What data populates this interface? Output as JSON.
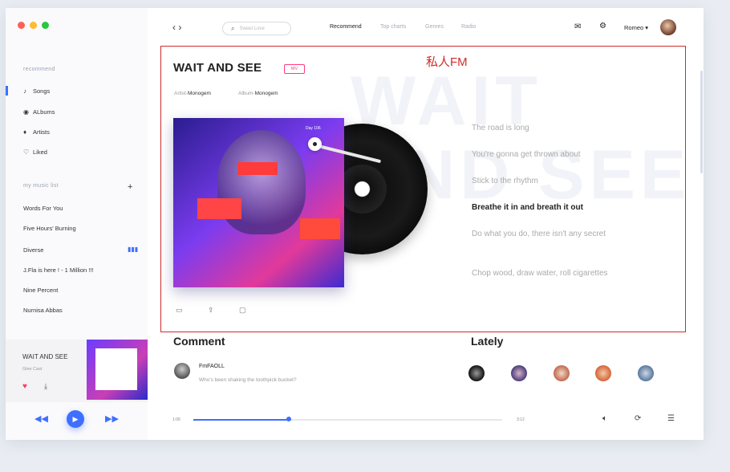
{
  "colors": {
    "accent": "#3f6fff",
    "annotation": "#d12b2b",
    "mv": "#ff3b7c",
    "heart": "#ff3b5c",
    "dot_red": "#ff5f57",
    "dot_yellow": "#febc2e",
    "dot_green": "#28c840"
  },
  "sidebar": {
    "recommend_title": "recommend",
    "nav": [
      {
        "label": "Songs",
        "icon": "note-icon",
        "glyph": "♪"
      },
      {
        "label": "ALbums",
        "icon": "disc-icon",
        "glyph": "◉"
      },
      {
        "label": "Artists",
        "icon": "mic-icon",
        "glyph": "♦"
      },
      {
        "label": "Liked",
        "icon": "heart-outline-icon",
        "glyph": "♡"
      }
    ],
    "music_list_title": "my music list",
    "add_glyph": "+",
    "playlists": [
      "Words For You",
      "Five Hours' Burning",
      "Diverse",
      "J.Fla is here !  - 1 Million !!!",
      "Nine Percent",
      "Nurnisa Abbas"
    ],
    "now_playing": {
      "title": "WAIT AND SEE",
      "artist": "Glee Cast"
    }
  },
  "top": {
    "search_placeholder": "Sweet Love",
    "tabs": [
      "Recommend",
      "Top charts",
      "Genres",
      "Radio"
    ],
    "user": "Romeo ▾"
  },
  "fm": {
    "annotation": "私人FM",
    "title": "WAIT AND SEE",
    "mv": "MV",
    "artist_label": "Artist-",
    "artist": "Monogem",
    "album_label": "Album-",
    "album": "Monogem",
    "cover_day": "Day 106",
    "bg_text": "WAIT AND SEE",
    "lyrics": [
      "The road is long",
      "You're gonna get thrown about",
      "Stick to the rhythm",
      "Breathe it in and breath it out",
      "Do what you do, there isn't any secret",
      "Chop wood, draw water, roll cigarettes"
    ],
    "current_lyric_index": 3
  },
  "comment": {
    "title": "Comment",
    "user": "FmFAOLL",
    "text": "Who's been shaking the toothpick bucket?"
  },
  "lately": {
    "title": "Lately"
  },
  "player": {
    "elapsed": "1:06",
    "total": "3:12",
    "progress": 0.31
  }
}
